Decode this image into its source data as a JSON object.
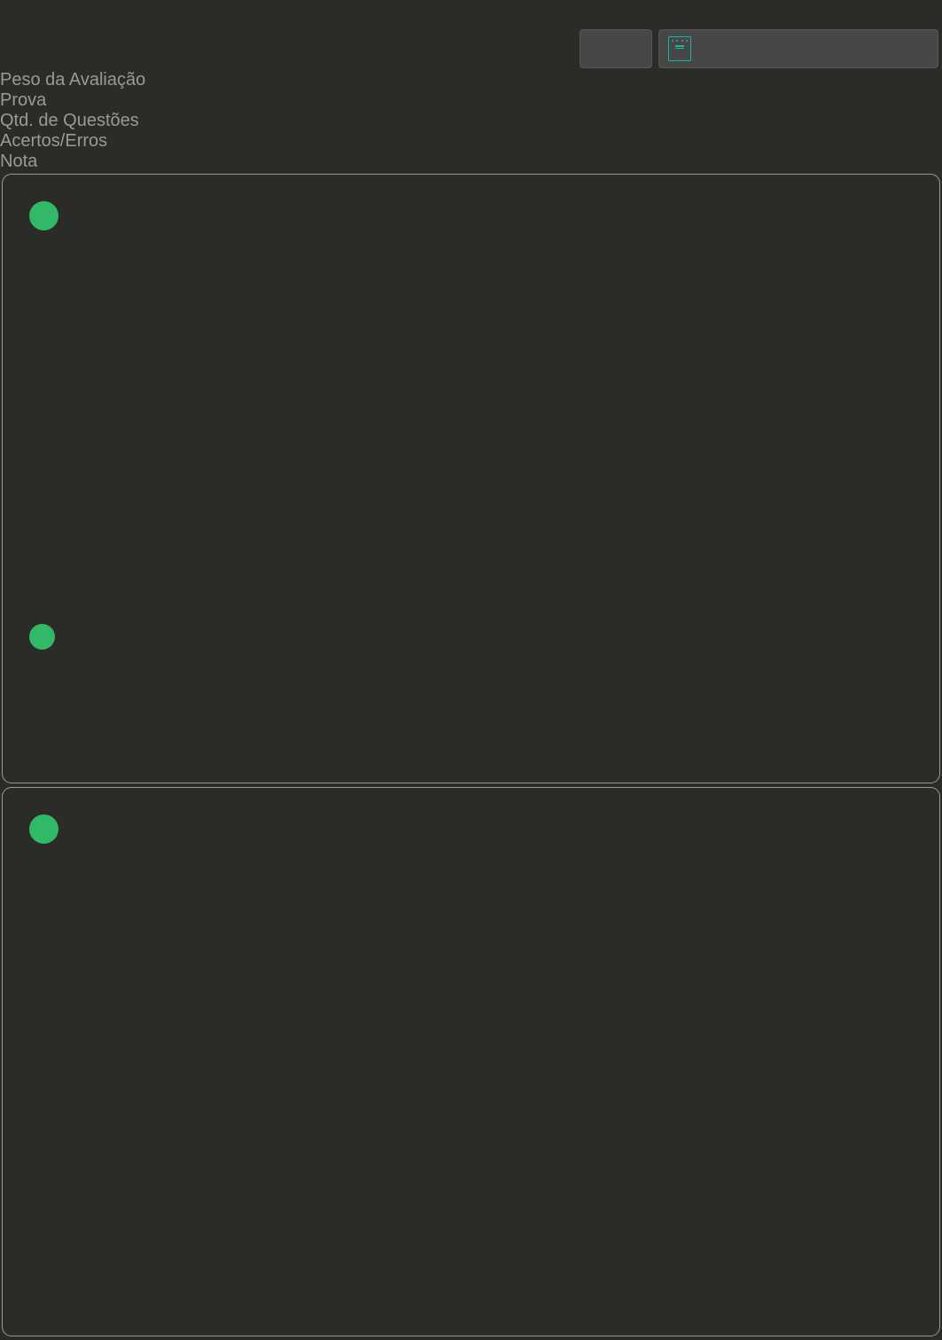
{
  "labels": {
    "peso": "Peso da Avaliação",
    "prova": "Prova",
    "qtd": "Qtd. de Questões",
    "acertos": "Acertos/Erros",
    "nota": "Nota"
  }
}
